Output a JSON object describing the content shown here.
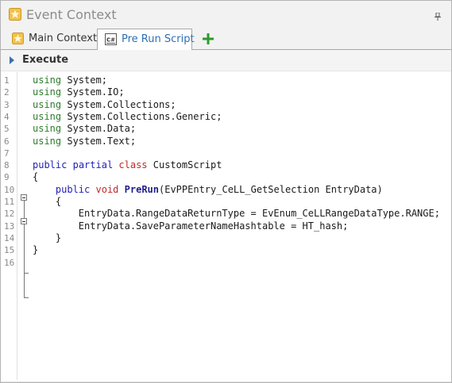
{
  "window": {
    "title": "Event Context",
    "title_icon": "star-icon",
    "pin_icon": "pin-icon"
  },
  "tabs": [
    {
      "label": "Main Context",
      "icon": "star-icon",
      "active": false
    },
    {
      "label": "Pre Run Script",
      "icon": "csharp-script-icon",
      "active": true
    }
  ],
  "add_tab_icon": "plus-icon",
  "toolbar": {
    "execute_label": "Execute",
    "execute_icon": "expand-arrow-icon"
  },
  "editor": {
    "line_numbers": [
      "1",
      "2",
      "3",
      "4",
      "5",
      "6",
      "7",
      "8",
      "9",
      "10",
      "11",
      "12",
      "13",
      "14",
      "15",
      "16"
    ],
    "lines": [
      {
        "parts": [
          {
            "t": "using",
            "c": "kw-green"
          },
          {
            "t": " System;",
            "c": ""
          }
        ]
      },
      {
        "parts": [
          {
            "t": "using",
            "c": "kw-green"
          },
          {
            "t": " System.IO;",
            "c": ""
          }
        ]
      },
      {
        "parts": [
          {
            "t": "using",
            "c": "kw-green"
          },
          {
            "t": " System.Collections;",
            "c": ""
          }
        ]
      },
      {
        "parts": [
          {
            "t": "using",
            "c": "kw-green"
          },
          {
            "t": " System.Collections.Generic;",
            "c": ""
          }
        ]
      },
      {
        "parts": [
          {
            "t": "using",
            "c": "kw-green"
          },
          {
            "t": " System.Data;",
            "c": ""
          }
        ]
      },
      {
        "parts": [
          {
            "t": "using",
            "c": "kw-green"
          },
          {
            "t": " System.Text;",
            "c": ""
          }
        ]
      },
      {
        "parts": []
      },
      {
        "parts": [
          {
            "t": "public",
            "c": "kw-blue"
          },
          {
            "t": " ",
            "c": ""
          },
          {
            "t": "partial",
            "c": "kw-blue"
          },
          {
            "t": " ",
            "c": ""
          },
          {
            "t": "class",
            "c": "kw-red"
          },
          {
            "t": " CustomScript",
            "c": ""
          }
        ]
      },
      {
        "parts": [
          {
            "t": "{",
            "c": ""
          }
        ]
      },
      {
        "parts": [
          {
            "t": "    ",
            "c": ""
          },
          {
            "t": "public",
            "c": "kw-blue"
          },
          {
            "t": " ",
            "c": ""
          },
          {
            "t": "void",
            "c": "kw-red"
          },
          {
            "t": " ",
            "c": ""
          },
          {
            "t": "PreRun",
            "c": "fn-bold"
          },
          {
            "t": "(EvPPEntry_CeLL_GetSelection EntryData)",
            "c": ""
          }
        ]
      },
      {
        "parts": [
          {
            "t": "    {",
            "c": ""
          }
        ]
      },
      {
        "parts": [
          {
            "t": "        EntryData.RangeDataReturnType = EvEnum_CeLLRangeDataType.RANGE;",
            "c": ""
          }
        ]
      },
      {
        "parts": [
          {
            "t": "        EntryData.SaveParameterNameHashtable = HT_hash;",
            "c": ""
          }
        ]
      },
      {
        "parts": [
          {
            "t": "    }",
            "c": ""
          }
        ]
      },
      {
        "parts": [
          {
            "t": "}",
            "c": ""
          }
        ]
      },
      {
        "parts": []
      }
    ]
  },
  "colors": {
    "keyword_green": "#2d7d2d",
    "keyword_blue": "#1f1fb8",
    "keyword_red": "#c0282a",
    "active_tab_text": "#2c6fb3",
    "add_icon_green": "#2e9a2e"
  }
}
